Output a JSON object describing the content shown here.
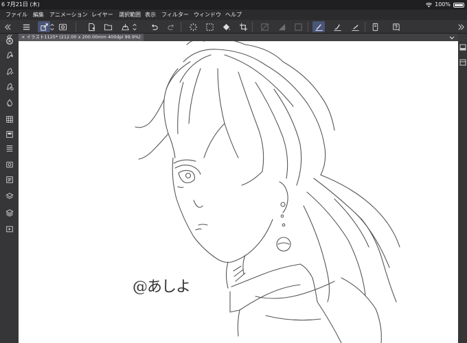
{
  "status_bar": {
    "time": "6  7月21日 (木)",
    "battery": "100%"
  },
  "menu": [
    {
      "id": "file",
      "label": "ファイル"
    },
    {
      "id": "edit",
      "label": "編集"
    },
    {
      "id": "animation",
      "label": "アニメーション"
    },
    {
      "id": "layer",
      "label": "レイヤー"
    },
    {
      "id": "selection",
      "label": "選択範囲"
    },
    {
      "id": "view",
      "label": "表示"
    },
    {
      "id": "filter",
      "label": "フィルター"
    },
    {
      "id": "window",
      "label": "ウィンドウ"
    },
    {
      "id": "help",
      "label": "ヘルプ"
    }
  ],
  "document_tab": {
    "label": "× イラスト1125* (212.00 x 200.00mm 400dpi 99.9%)"
  },
  "canvas": {
    "signature": "@あしよ"
  },
  "colors": {
    "menubar": "#2b2b2d",
    "toolbar": "#343436",
    "active_tool": "#4a5678",
    "canvas": "#ffffff"
  }
}
